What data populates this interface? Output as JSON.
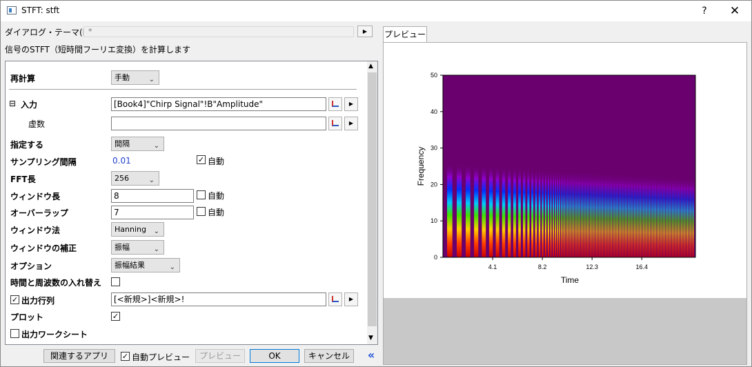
{
  "window": {
    "title": "STFT: stft",
    "help": "?",
    "close": "✕"
  },
  "theme": {
    "label": "ダイアログ・テーマ(H)",
    "value": "*",
    "arrow": "▶"
  },
  "description": "信号のSTFT（短時間フーリエ変換）を計算します",
  "form": {
    "recalc": {
      "label": "再計算",
      "value": "手動"
    },
    "input": {
      "label": "入力",
      "toggle": "⊟",
      "value": "[Book4]\"Chirp Signal\"!B\"Amplitude\""
    },
    "imag": {
      "label": "虚数",
      "value": ""
    },
    "specify": {
      "label": "指定する",
      "value": "間隔"
    },
    "sampling": {
      "label": "サンプリング間隔",
      "value": "0.01",
      "auto": "自動",
      "auto_checked": true
    },
    "fft": {
      "label": "FFT長",
      "value": "256"
    },
    "window_len": {
      "label": "ウィンドウ長",
      "value": "8",
      "auto": "自動",
      "auto_checked": false
    },
    "overlap": {
      "label": "オーバーラップ",
      "value": "7",
      "auto": "自動",
      "auto_checked": false
    },
    "window_method": {
      "label": "ウィンドウ法",
      "value": "Hanning"
    },
    "window_corr": {
      "label": "ウィンドウの補正",
      "value": "振幅"
    },
    "option": {
      "label": "オプション",
      "value": "振幅結果"
    },
    "swap": {
      "label": "時間と周波数の入れ替え",
      "checked": false
    },
    "out_matrix": {
      "label": "出力行列",
      "checked": true,
      "value": "[<新規>]<新規>!"
    },
    "plot": {
      "label": "プロット",
      "checked": true
    },
    "out_sheet": {
      "label": "出力ワークシート",
      "checked": false
    }
  },
  "buttons": {
    "related": "関連するアプリ",
    "auto_preview": "自動プレビュー",
    "auto_preview_checked": true,
    "preview": "プレビュー",
    "ok": "OK",
    "cancel": "キャンセル",
    "collapse": "«"
  },
  "preview_tab": "プレビュー",
  "chart_data": {
    "type": "heatmap",
    "xlabel": "Time",
    "ylabel": "Frequency",
    "x_ticks": [
      "4.1",
      "8.2",
      "12.3",
      "16.4"
    ],
    "y_ticks": [
      "0",
      "10",
      "20",
      "30",
      "40",
      "50"
    ],
    "ylim": [
      0,
      50
    ],
    "colors": {
      "high": "#cc0000",
      "low": "#6a006e"
    }
  }
}
